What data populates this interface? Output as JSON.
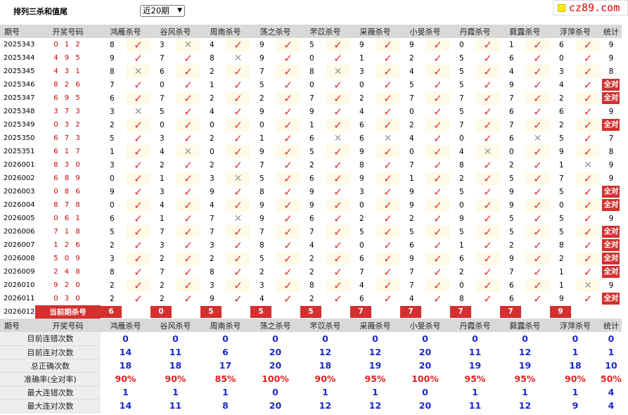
{
  "header": {
    "title": "排列三杀和值尾",
    "period_selected": "近20期",
    "site": "cz89.com"
  },
  "columns": {
    "issue": "期号",
    "winning": "开奖号码",
    "kill": [
      "鸿雁杀号",
      "谷风杀号",
      "周南杀号",
      "荡之杀号",
      "芣苡杀号",
      "采薇杀号",
      "小旻杀号",
      "丹霞杀号",
      "蕤露杀号",
      "浮萍杀号"
    ],
    "stat": "统计"
  },
  "rows": [
    {
      "issue": "2025343",
      "win": "0 1 2",
      "vals": [
        "8",
        "3",
        "4",
        "9",
        "5",
        "9",
        "9",
        "0",
        "1",
        "6"
      ],
      "hits": [
        1,
        0,
        1,
        1,
        1,
        1,
        1,
        1,
        1,
        1
      ],
      "stat": "9"
    },
    {
      "issue": "2025344",
      "win": "4 9 5",
      "vals": [
        "9",
        "7",
        "8",
        "9",
        "0",
        "1",
        "2",
        "5",
        "6",
        "0"
      ],
      "hits": [
        1,
        1,
        0,
        1,
        1,
        1,
        1,
        1,
        1,
        1
      ],
      "stat": "9"
    },
    {
      "issue": "2025345",
      "win": "4 3 1",
      "vals": [
        "8",
        "6",
        "2",
        "7",
        "8",
        "3",
        "4",
        "5",
        "4",
        "3"
      ],
      "hits": [
        0,
        1,
        1,
        1,
        0,
        1,
        1,
        1,
        1,
        1
      ],
      "stat": "8"
    },
    {
      "issue": "2025346",
      "win": "8 2 6",
      "vals": [
        "7",
        "0",
        "1",
        "5",
        "0",
        "0",
        "5",
        "5",
        "9",
        "4"
      ],
      "hits": [
        1,
        1,
        1,
        1,
        1,
        1,
        1,
        1,
        1,
        1
      ],
      "stat": "全对"
    },
    {
      "issue": "2025347",
      "win": "6 9 5",
      "vals": [
        "6",
        "7",
        "2",
        "2",
        "7",
        "2",
        "7",
        "7",
        "7",
        "2"
      ],
      "hits": [
        1,
        1,
        1,
        1,
        1,
        1,
        1,
        1,
        1,
        1
      ],
      "stat": "全对"
    },
    {
      "issue": "2025348",
      "win": "3 7 3",
      "vals": [
        "3",
        "5",
        "4",
        "9",
        "9",
        "4",
        "0",
        "5",
        "6",
        "6"
      ],
      "hits": [
        0,
        1,
        1,
        1,
        1,
        1,
        1,
        1,
        1,
        1
      ],
      "stat": "9"
    },
    {
      "issue": "2025349",
      "win": "0 3 2",
      "vals": [
        "2",
        "0",
        "0",
        "0",
        "1",
        "6",
        "2",
        "7",
        "7",
        "2"
      ],
      "hits": [
        1,
        1,
        1,
        1,
        1,
        1,
        1,
        1,
        1,
        1
      ],
      "stat": "全对"
    },
    {
      "issue": "2025350",
      "win": "6 7 3",
      "vals": [
        "5",
        "3",
        "2",
        "1",
        "6",
        "6",
        "4",
        "0",
        "6",
        "5"
      ],
      "hits": [
        1,
        1,
        1,
        1,
        0,
        0,
        1,
        1,
        0,
        1
      ],
      "stat": "7"
    },
    {
      "issue": "2025351",
      "win": "6 1 7",
      "vals": [
        "1",
        "4",
        "0",
        "9",
        "5",
        "9",
        "0",
        "4",
        "0",
        "9"
      ],
      "hits": [
        1,
        0,
        1,
        1,
        1,
        1,
        1,
        0,
        1,
        1
      ],
      "stat": "8"
    },
    {
      "issue": "2026001",
      "win": "8 3 0",
      "vals": [
        "3",
        "2",
        "2",
        "7",
        "2",
        "8",
        "7",
        "8",
        "2",
        "1"
      ],
      "hits": [
        1,
        1,
        1,
        1,
        1,
        1,
        1,
        1,
        1,
        0
      ],
      "stat": "9"
    },
    {
      "issue": "2026002",
      "win": "6 8 9",
      "vals": [
        "0",
        "1",
        "3",
        "5",
        "6",
        "9",
        "1",
        "2",
        "5",
        "7"
      ],
      "hits": [
        1,
        1,
        0,
        1,
        1,
        1,
        1,
        1,
        1,
        1
      ],
      "stat": "9"
    },
    {
      "issue": "2026003",
      "win": "0 8 6",
      "vals": [
        "9",
        "3",
        "9",
        "8",
        "9",
        "3",
        "9",
        "5",
        "9",
        "5"
      ],
      "hits": [
        1,
        1,
        1,
        1,
        1,
        1,
        1,
        1,
        1,
        1
      ],
      "stat": "全对"
    },
    {
      "issue": "2026004",
      "win": "8 7 8",
      "vals": [
        "0",
        "4",
        "4",
        "9",
        "9",
        "0",
        "9",
        "0",
        "9",
        "0"
      ],
      "hits": [
        1,
        1,
        1,
        1,
        1,
        1,
        1,
        1,
        1,
        1
      ],
      "stat": "全对"
    },
    {
      "issue": "2026005",
      "win": "0 6 1",
      "vals": [
        "6",
        "1",
        "7",
        "9",
        "6",
        "2",
        "2",
        "9",
        "5",
        "5"
      ],
      "hits": [
        1,
        1,
        0,
        1,
        1,
        1,
        1,
        1,
        1,
        1
      ],
      "stat": "9"
    },
    {
      "issue": "2026006",
      "win": "7 1 8",
      "vals": [
        "5",
        "7",
        "7",
        "7",
        "7",
        "5",
        "5",
        "5",
        "5",
        "5"
      ],
      "hits": [
        1,
        1,
        1,
        1,
        1,
        1,
        1,
        1,
        1,
        1
      ],
      "stat": "全对"
    },
    {
      "issue": "2026007",
      "win": "1 2 6",
      "vals": [
        "2",
        "3",
        "3",
        "8",
        "4",
        "0",
        "6",
        "1",
        "2",
        "8"
      ],
      "hits": [
        1,
        1,
        1,
        1,
        1,
        1,
        1,
        1,
        1,
        1
      ],
      "stat": "全对"
    },
    {
      "issue": "2026008",
      "win": "5 0 9",
      "vals": [
        "3",
        "2",
        "2",
        "5",
        "2",
        "6",
        "9",
        "6",
        "9",
        "2"
      ],
      "hits": [
        1,
        1,
        1,
        1,
        1,
        1,
        1,
        1,
        1,
        1
      ],
      "stat": "全对"
    },
    {
      "issue": "2026009",
      "win": "2 4 8",
      "vals": [
        "8",
        "7",
        "8",
        "2",
        "2",
        "7",
        "7",
        "2",
        "7",
        "1"
      ],
      "hits": [
        1,
        1,
        1,
        1,
        1,
        1,
        1,
        1,
        1,
        1
      ],
      "stat": "全对"
    },
    {
      "issue": "2026010",
      "win": "9 2 0",
      "vals": [
        "2",
        "2",
        "3",
        "3",
        "8",
        "4",
        "7",
        "0",
        "6",
        "1"
      ],
      "hits": [
        1,
        1,
        1,
        1,
        1,
        1,
        1,
        1,
        1,
        0
      ],
      "stat": "9"
    },
    {
      "issue": "2026011",
      "win": "0 3 0",
      "vals": [
        "2",
        "2",
        "9",
        "4",
        "2",
        "6",
        "4",
        "8",
        "6",
        "9"
      ],
      "hits": [
        1,
        1,
        1,
        1,
        1,
        1,
        1,
        1,
        1,
        1
      ],
      "stat": "全对"
    }
  ],
  "current": {
    "issue": "2026012",
    "label": "当前期杀号",
    "vals": [
      "6",
      "0",
      "5",
      "5",
      "5",
      "7",
      "7",
      "7",
      "7",
      "9"
    ]
  },
  "summary": [
    {
      "label": "目前连错次数",
      "vals": [
        "0",
        "0",
        "0",
        "0",
        "0",
        "0",
        "0",
        "0",
        "0",
        "0"
      ],
      "stat": "0",
      "red": false
    },
    {
      "label": "目前连对次数",
      "vals": [
        "14",
        "11",
        "6",
        "20",
        "12",
        "12",
        "20",
        "11",
        "12",
        "1"
      ],
      "stat": "1",
      "red": false
    },
    {
      "label": "总正确次数",
      "vals": [
        "18",
        "18",
        "17",
        "20",
        "18",
        "19",
        "20",
        "19",
        "19",
        "18"
      ],
      "stat": "10",
      "red": false
    },
    {
      "label": "准确率(全对率)",
      "vals": [
        "90%",
        "90%",
        "85%",
        "100%",
        "90%",
        "95%",
        "100%",
        "95%",
        "95%",
        "90%"
      ],
      "stat": "50%",
      "red": true
    },
    {
      "label": "最大连错次数",
      "vals": [
        "1",
        "1",
        "1",
        "0",
        "1",
        "1",
        "0",
        "1",
        "1",
        "1"
      ],
      "stat": "4",
      "red": false
    },
    {
      "label": "最大连对次数",
      "vals": [
        "14",
        "11",
        "8",
        "20",
        "12",
        "12",
        "20",
        "11",
        "12",
        "9"
      ],
      "stat": "4",
      "red": false
    }
  ]
}
